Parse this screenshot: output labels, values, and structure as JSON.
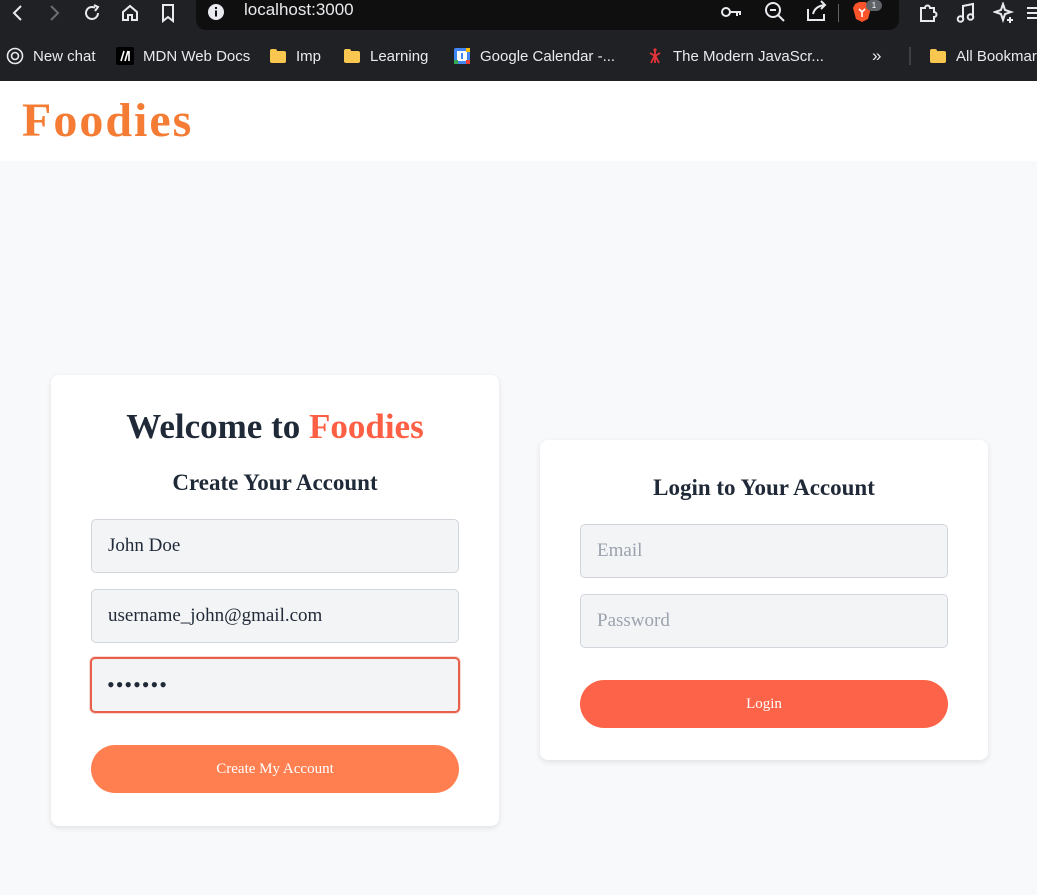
{
  "browser": {
    "url": "localhost:3000",
    "extension_badge": "1",
    "bookmarks": [
      {
        "label": "New chat",
        "icon": "chatgpt-icon"
      },
      {
        "label": "MDN Web Docs",
        "icon": "mdn-icon"
      },
      {
        "label": "Imp",
        "icon": "folder-icon"
      },
      {
        "label": "Learning",
        "icon": "folder-icon"
      },
      {
        "label": "Google Calendar -...",
        "icon": "google-calendar-icon"
      },
      {
        "label": "The Modern JavaScr...",
        "icon": "javascript-info-icon"
      },
      {
        "label": "All Bookmar",
        "icon": "folder-icon"
      }
    ],
    "more_bookmarks": "»"
  },
  "app": {
    "logo": "Foodies",
    "brand_color": "#f47c34",
    "accent_color": "#fd5f45"
  },
  "signup": {
    "welcome_prefix": "Welcome to",
    "welcome_brand": "Foodies",
    "subtitle": "Create Your Account",
    "name_value": "John Doe",
    "email_value": "username_john@gmail.com",
    "password_value": "•••••••",
    "button": "Create My Account"
  },
  "login": {
    "subtitle": "Login to Your Account",
    "email_placeholder": "Email",
    "password_placeholder": "Password",
    "button": "Login"
  }
}
